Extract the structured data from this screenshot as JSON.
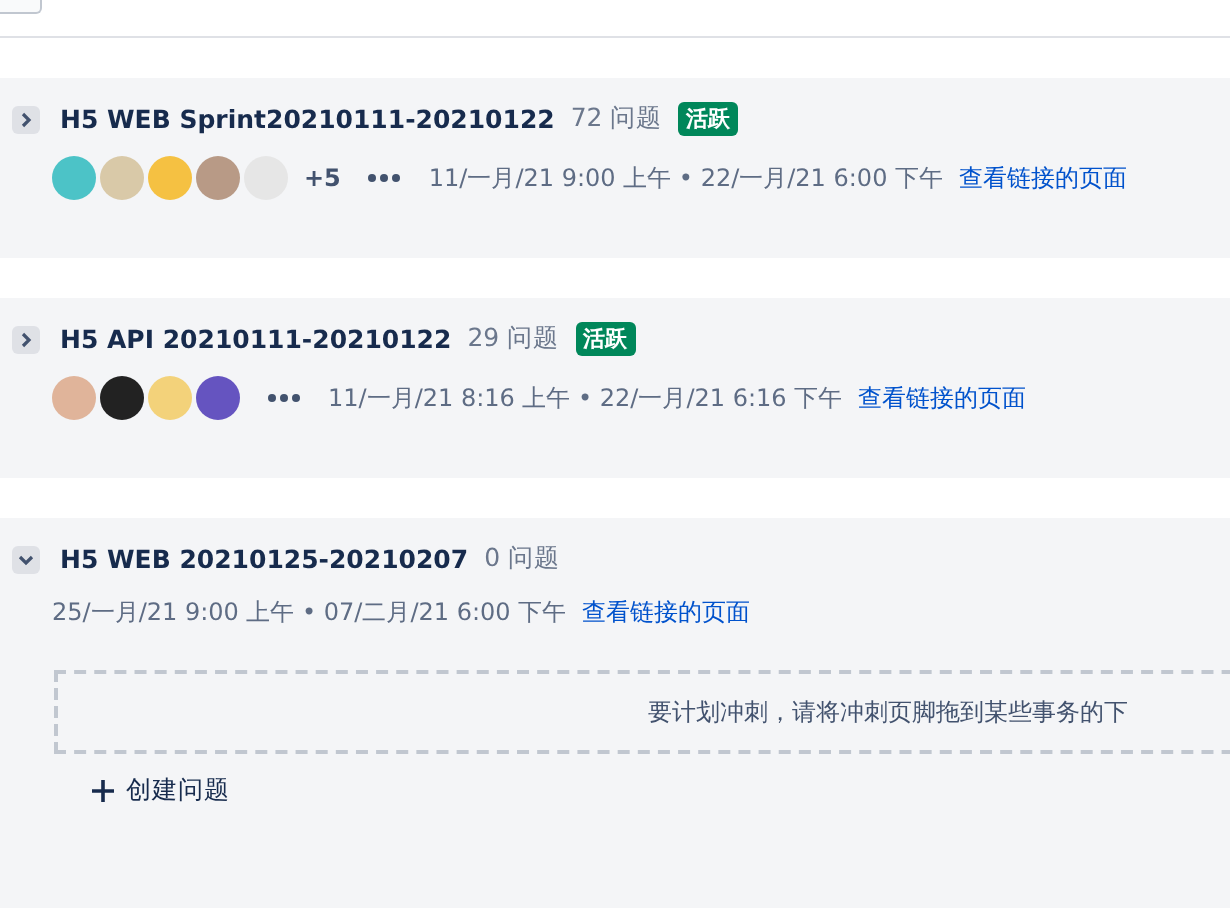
{
  "sprints": [
    {
      "name": "H5 WEB Sprint20210111-20210122",
      "count": "72 问题",
      "badge": "活跃",
      "expanded": false,
      "avatars": [
        {
          "color": "#4cc3c7"
        },
        {
          "color": "#d9c9a8"
        },
        {
          "color": "#f5c142"
        },
        {
          "color": "#b89a86"
        },
        {
          "color": "#e6e6e6"
        }
      ],
      "more": "+5",
      "dates": "11/一月/21 9:00 上午 • 22/一月/21 6:00 下午",
      "link": "查看链接的页面"
    },
    {
      "name": "H5 API 20210111-20210122",
      "count": "29 问题",
      "badge": "活跃",
      "expanded": false,
      "avatars": [
        {
          "color": "#e0b49a"
        },
        {
          "color": "#222222"
        },
        {
          "color": "#f3d27a"
        },
        {
          "color": "#6554c0"
        }
      ],
      "dates": "11/一月/21 8:16 上午 • 22/一月/21 6:16 下午",
      "link": "查看链接的页面"
    },
    {
      "name": "H5 WEB 20210125-20210207",
      "count": "0 问题",
      "expanded": true,
      "dates": "25/一月/21 9:00 上午 • 07/二月/21 6:00 下午",
      "link": "查看链接的页面",
      "drop_hint": "要计划冲刺，请将冲刺页脚拖到某些事务的下",
      "create": "创建问题"
    }
  ]
}
